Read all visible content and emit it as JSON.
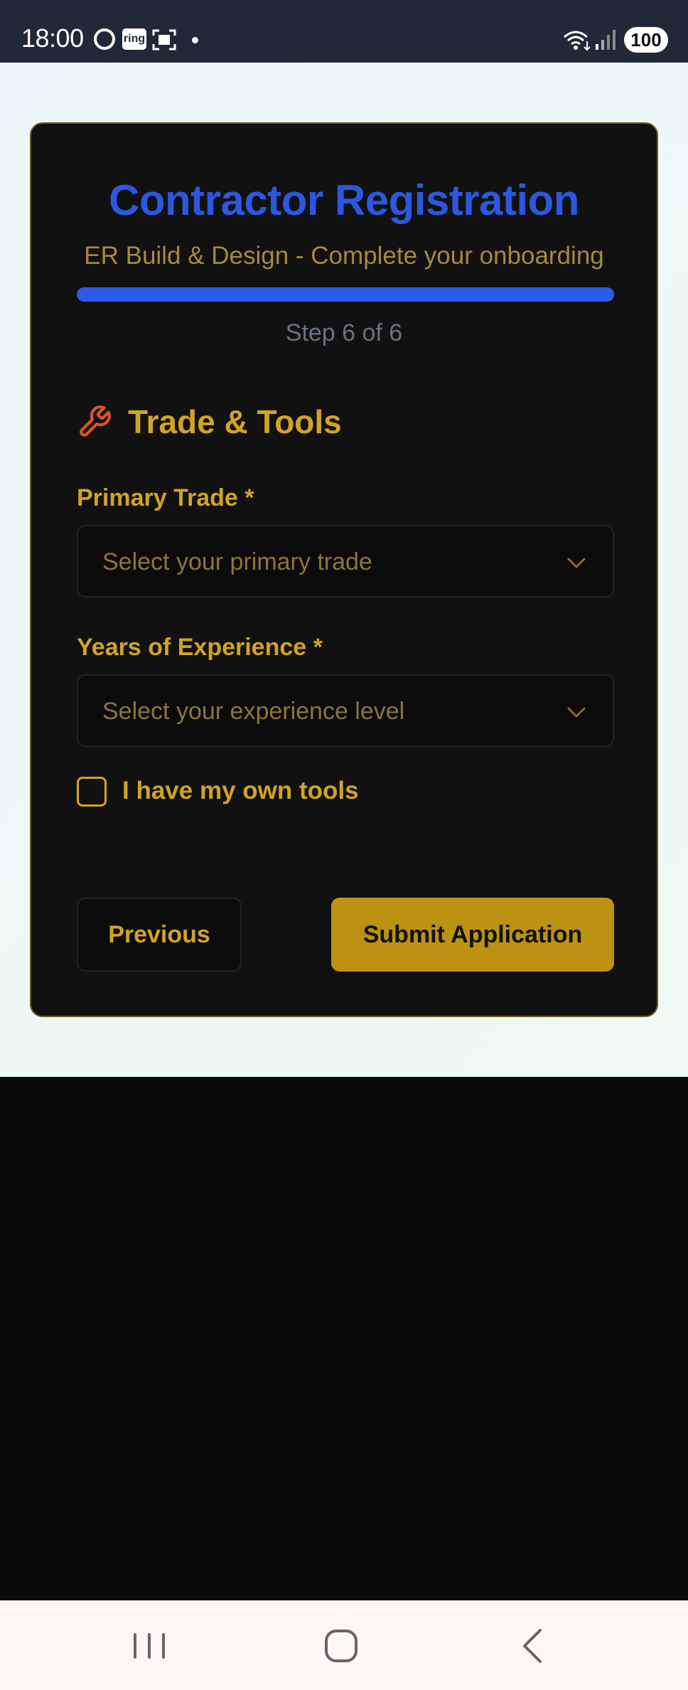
{
  "status_bar": {
    "time": "18:00",
    "ring_badge": "ring",
    "battery": "100",
    "icons": [
      "ring-app-icon",
      "ring-badge-icon",
      "screenshot-icon",
      "notification-dot-icon",
      "wifi-icon",
      "signal-icon",
      "battery-icon"
    ]
  },
  "header": {
    "title": "Contractor Registration",
    "subtitle": "ER Build & Design - Complete your onboarding",
    "progress_fraction": 1.0,
    "step_text": "Step 6 of 6"
  },
  "section": {
    "icon": "wrench-icon",
    "title": "Trade & Tools"
  },
  "fields": {
    "primary_trade": {
      "label": "Primary Trade *",
      "placeholder": "Select your primary trade"
    },
    "experience": {
      "label": "Years of Experience *",
      "placeholder": "Select your experience level"
    },
    "own_tools": {
      "label": "I have my own tools",
      "checked": false
    }
  },
  "actions": {
    "previous": "Previous",
    "submit": "Submit Application"
  },
  "colors": {
    "accent_gold": "#d2a324",
    "title_blue": "#2c58e0",
    "progress_blue": "#2b5ce8",
    "submit_bg": "#bd9213",
    "card_bg": "#111111"
  },
  "nav_bar": {
    "icons": [
      "recent-apps-icon",
      "home-icon",
      "back-icon"
    ]
  }
}
